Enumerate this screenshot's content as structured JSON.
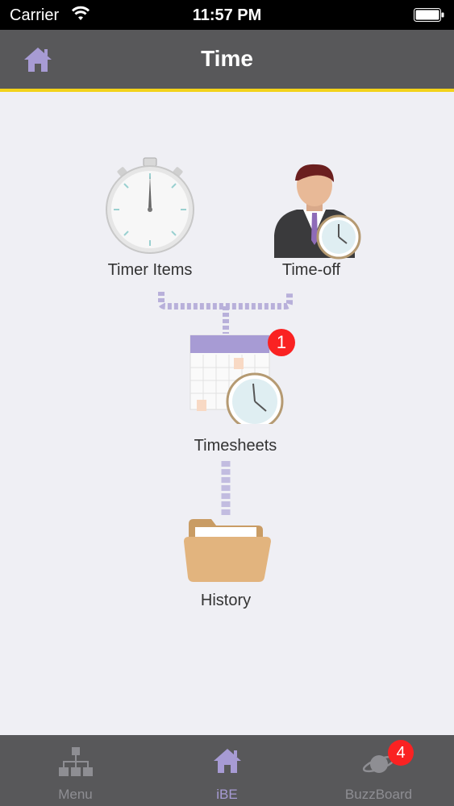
{
  "status_bar": {
    "carrier": "Carrier",
    "time": "11:57 PM"
  },
  "nav": {
    "title": "Time",
    "home_icon": "home-icon"
  },
  "tiles": {
    "timer_items": {
      "label": "Timer Items",
      "icon": "stopwatch-icon"
    },
    "time_off": {
      "label": "Time-off",
      "icon": "person-clock-icon"
    },
    "timesheets": {
      "label": "Timesheets",
      "icon": "calendar-clock-icon",
      "badge": "1"
    },
    "history": {
      "label": "History",
      "icon": "folder-icon"
    }
  },
  "tabs": [
    {
      "label": "Menu",
      "icon": "org-chart-icon",
      "active": false
    },
    {
      "label": "iBE",
      "icon": "home-icon",
      "active": true
    },
    {
      "label": "BuzzBoard",
      "icon": "planet-icon",
      "badge": "4",
      "active": false
    }
  ],
  "colors": {
    "nav_bg": "#58585a",
    "accent_line": "#f2d21a",
    "active_tab": "#a79bd4",
    "inactive_tab": "#8e8e93",
    "badge": "#fa2222"
  }
}
